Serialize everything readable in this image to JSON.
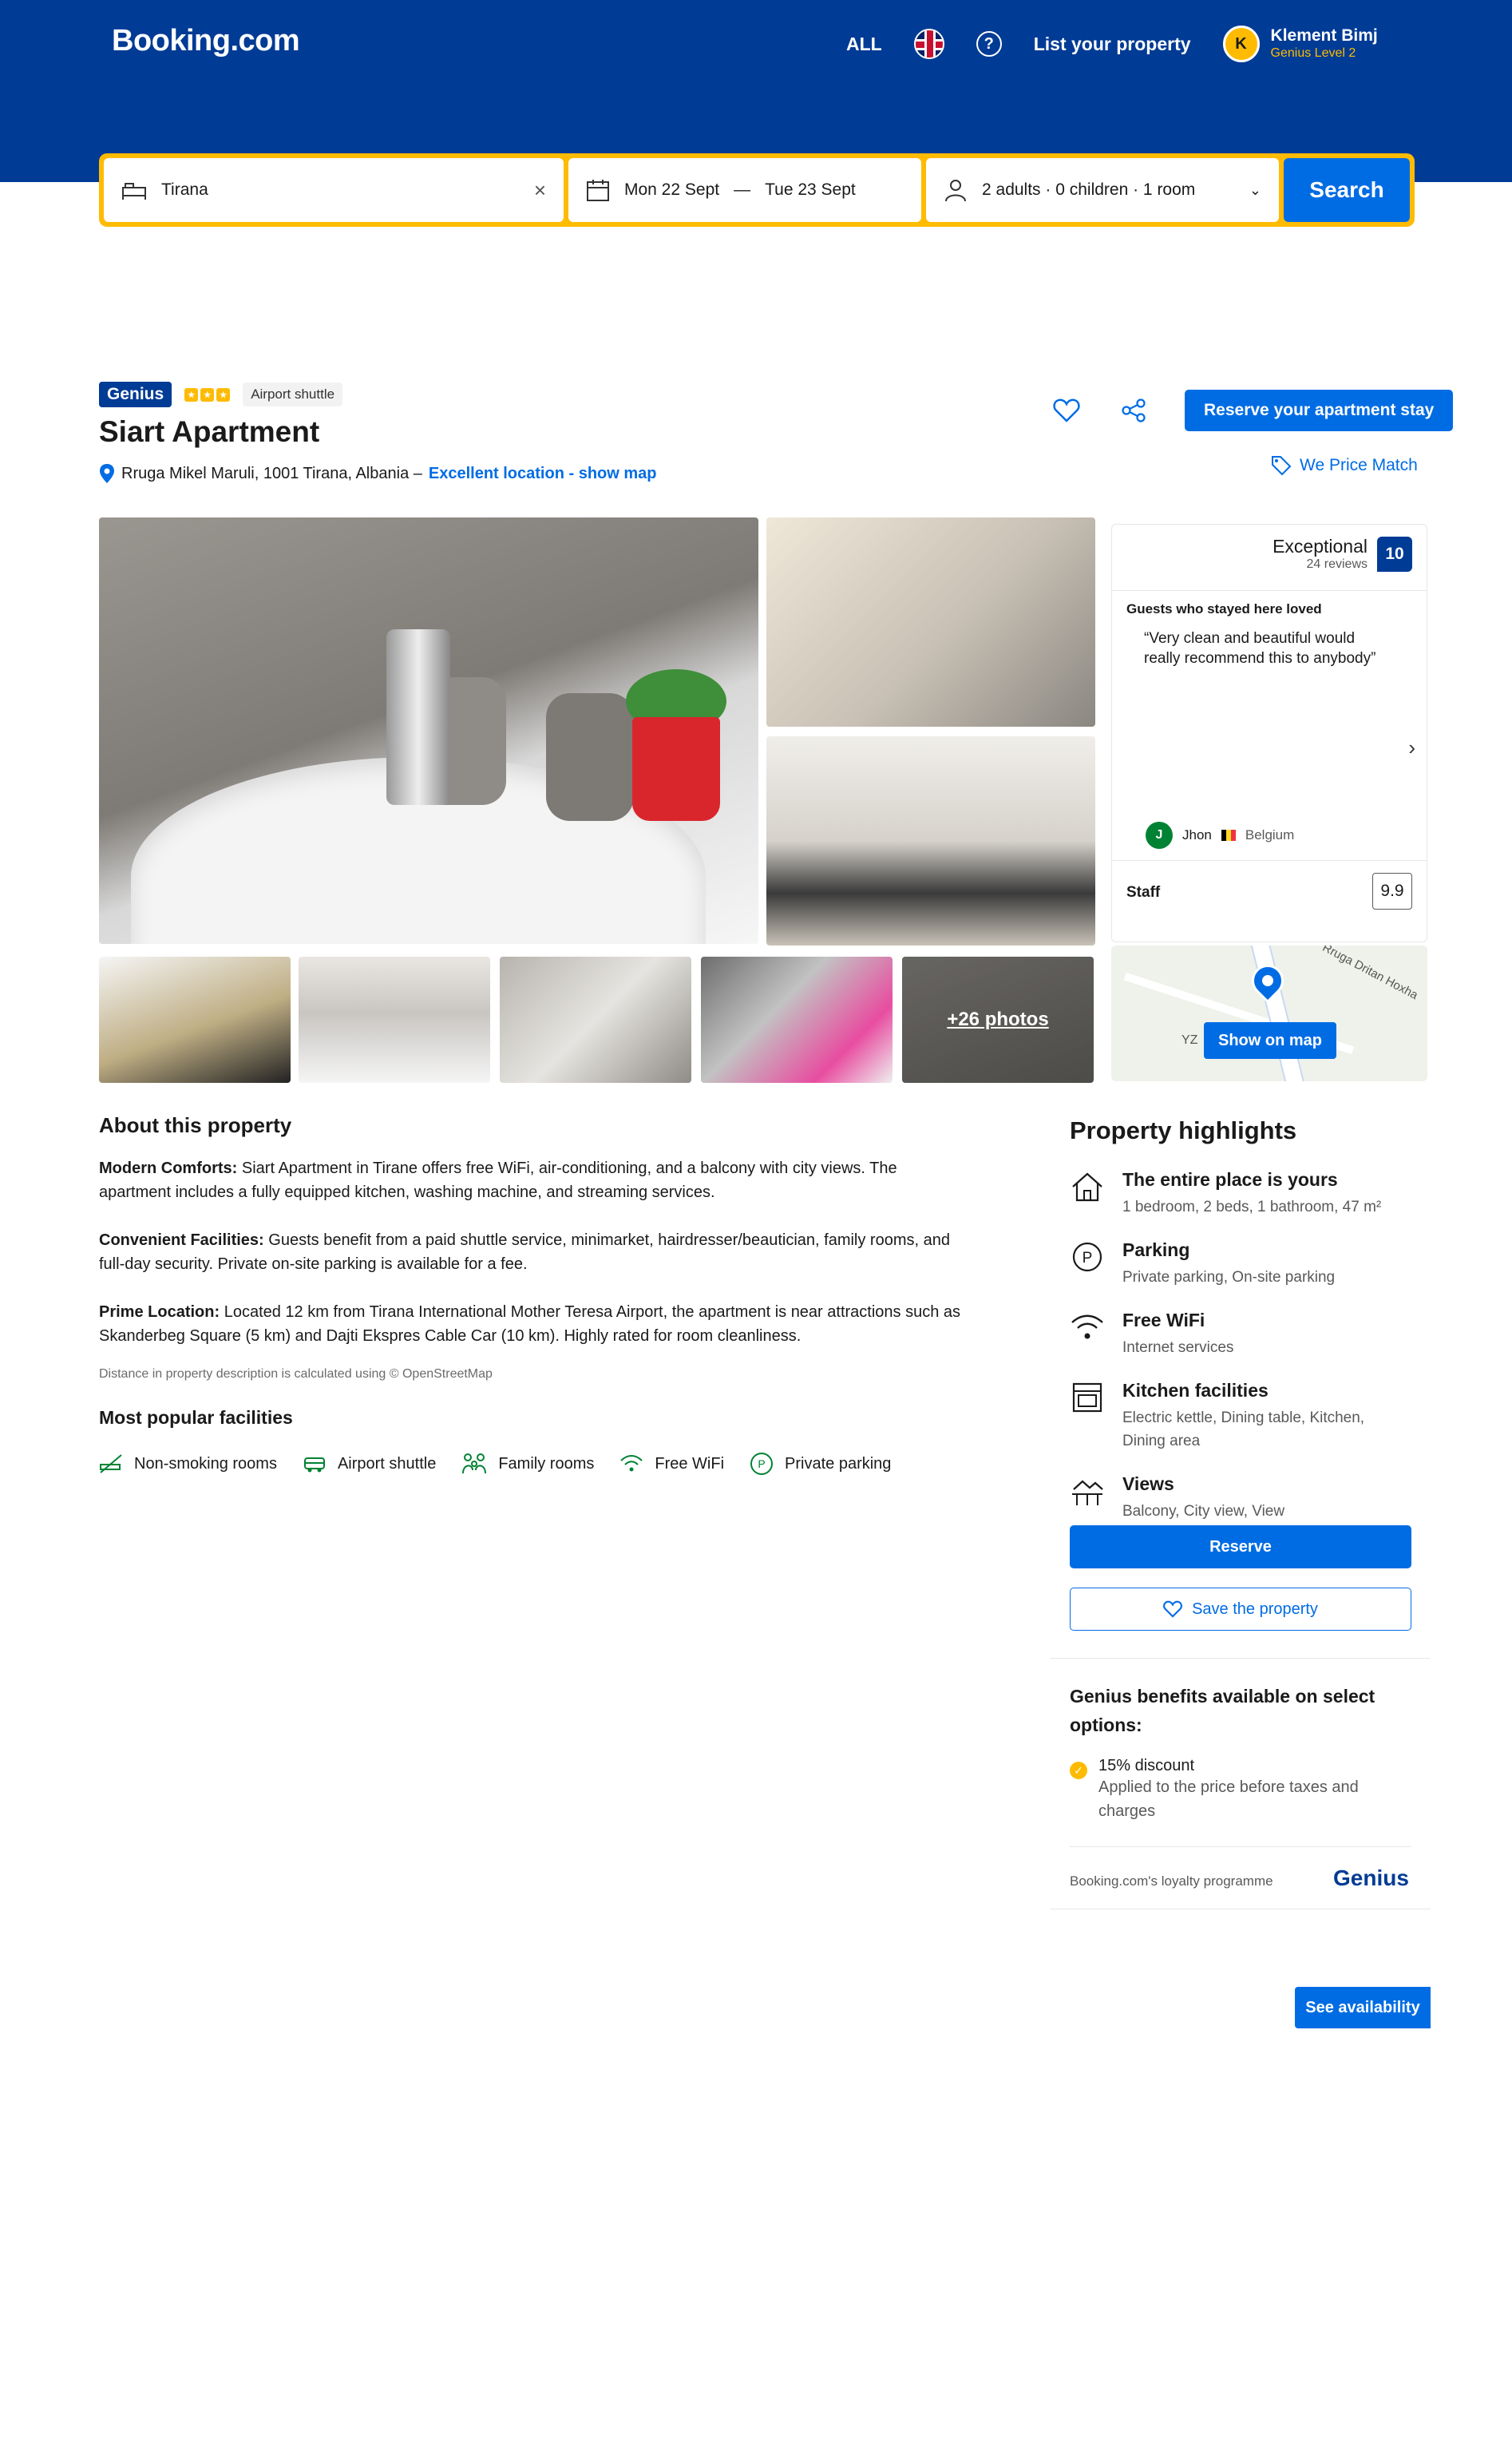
{
  "header": {
    "logo": "Booking.com",
    "currency": "ALL",
    "language_icon": "uk-flag-icon",
    "help_icon": "question-circle-icon",
    "list_property": "List your property",
    "user": {
      "initial": "K",
      "name": "Klement Bimj",
      "level": "Genius Level 2"
    },
    "colors": {
      "header_bg": "#003b95",
      "search_border": "#febb02",
      "accent": "#006ce4"
    }
  },
  "search": {
    "destination": "Tirana",
    "checkin": "Mon 22 Sept",
    "dash": "—",
    "checkout": "Tue 23 Sept",
    "occupancy": "2 adults · 0 children · 1 room",
    "button": "Search"
  },
  "property": {
    "genius_label": "Genius",
    "tag": "Airport shuttle",
    "title": "Siart Apartment",
    "address": "Rruga Mikel Maruli, 1001 Tirana, Albania –",
    "location_link": "Excellent location - show map",
    "reserve_top": "Reserve your apartment stay",
    "price_match": "We Price Match"
  },
  "gallery": {
    "more_photos": "+26 photos"
  },
  "review": {
    "word": "Exceptional",
    "count": "24 reviews",
    "score": "10",
    "loved_heading": "Guests who stayed here loved",
    "quote": "“Very clean and beautiful would really recommend this to anybody”",
    "reviewer_initial": "J",
    "reviewer_name": "Jhon",
    "reviewer_country": "Belgium",
    "staff_label": "Staff",
    "staff_score": "9.9",
    "map_road_label": "Rruga Dritan Hoxha",
    "map_place_label": "YZ",
    "show_map": "Show on map"
  },
  "about": {
    "title": "About this property",
    "p1_head": "Modern Comforts:",
    "p1_body": " Siart Apartment in Tirane offers free WiFi, air-conditioning, and a balcony with city views. The apartment includes a fully equipped kitchen, washing machine, and streaming services.",
    "p2_head": "Convenient Facilities:",
    "p2_body": " Guests benefit from a paid shuttle service, minimarket, hairdresser/beautician, family rooms, and full-day security. Private on-site parking is available for a fee.",
    "p3_head": "Prime Location:",
    "p3_body": " Located 12 km from Tirana International Mother Teresa Airport, the apartment is near attractions such as Skanderbeg Square (5 km) and Dajti Ekspres Cable Car (10 km). Highly rated for room cleanliness.",
    "disclaimer": "Distance in property description is calculated using © OpenStreetMap",
    "popular_title": "Most popular facilities",
    "facilities": [
      "Non-smoking rooms",
      "Airport shuttle",
      "Family rooms",
      "Free WiFi",
      "Private parking"
    ]
  },
  "highlights": {
    "title": "Property highlights",
    "items": [
      {
        "name": "The entire place is yours",
        "desc": "1 bedroom, 2 beds, 1 bathroom, 47 m²",
        "icon": "house-icon"
      },
      {
        "name": "Parking",
        "desc": "Private parking, On-site parking",
        "icon": "parking-icon"
      },
      {
        "name": "Free WiFi",
        "desc": "Internet services",
        "icon": "wifi-icon"
      },
      {
        "name": "Kitchen facilities",
        "desc": "Electric kettle, Dining table, Kitchen, Dining area",
        "icon": "oven-icon"
      },
      {
        "name": "Views",
        "desc": "Balcony, City view, View",
        "icon": "view-icon"
      }
    ],
    "reserve": "Reserve",
    "save": "Save the property",
    "genius_title": "Genius benefits available on select options:",
    "genius_item_name": "15% discount",
    "genius_item_desc": "Applied to the price before taxes and charges",
    "loyalty": "Booking.com's loyalty programme",
    "genius_word": "Genius",
    "see_availability": "See availability"
  }
}
